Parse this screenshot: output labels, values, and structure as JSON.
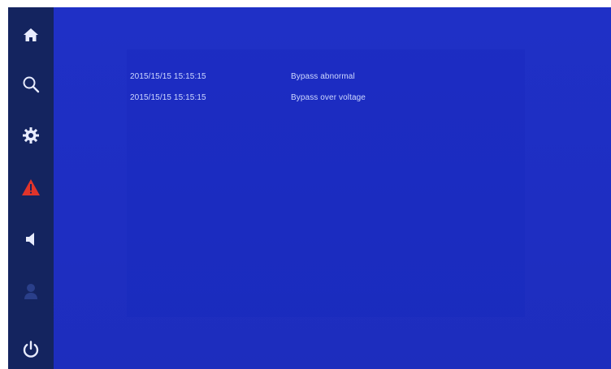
{
  "colors": {
    "background": "#1f2fc4",
    "sidebar": "#14245f",
    "icon": "#e8ecff",
    "alarm_accent": "#e0342b",
    "muted_icon": "#2a3f8a",
    "text": "#cfd8ff"
  },
  "sidebar": {
    "items": [
      {
        "icon": "home-icon",
        "active": false
      },
      {
        "icon": "search-icon",
        "active": false
      },
      {
        "icon": "gear-icon",
        "active": false
      },
      {
        "icon": "warning-icon",
        "active": true
      },
      {
        "icon": "speaker-icon",
        "active": false
      },
      {
        "icon": "user-icon",
        "active": false,
        "disabled": true
      },
      {
        "icon": "power-icon",
        "active": false
      }
    ]
  },
  "alarms": [
    {
      "time": "2015/15/15 15:15:15",
      "description": "Bypass abnormal"
    },
    {
      "time": "2015/15/15 15:15:15",
      "description": "Bypass over voltage"
    }
  ]
}
